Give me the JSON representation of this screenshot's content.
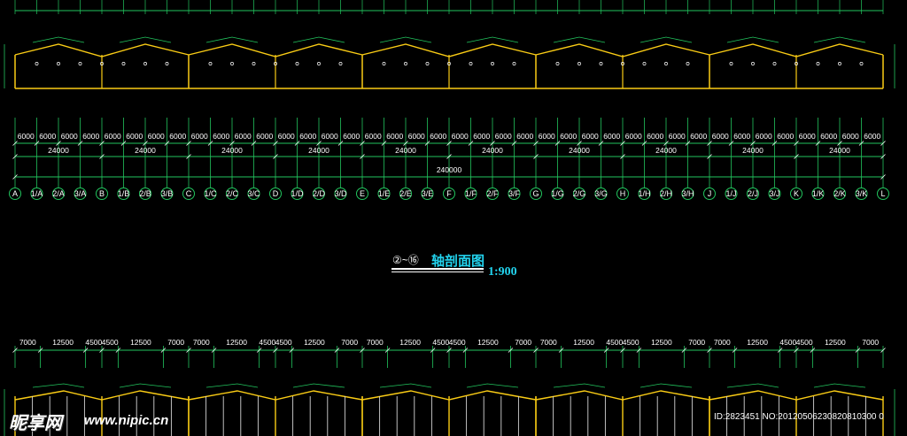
{
  "colors": {
    "background": "#000000",
    "dim_line": "#22c55e",
    "frame": "#facc15",
    "title": "#22d3ee",
    "text": "#ffffff"
  },
  "top_dim_row": {
    "bays": [
      "6000",
      "6000",
      "6000",
      "6000",
      "6000",
      "6000",
      "6000",
      "6000",
      "6000",
      "6000",
      "6000",
      "6000",
      "6000",
      "6000",
      "6000",
      "6000",
      "6000",
      "6000",
      "6000",
      "6000",
      "6000",
      "6000",
      "6000",
      "6000",
      "6000",
      "6000",
      "6000",
      "6000",
      "6000",
      "6000",
      "6000",
      "6000",
      "6000",
      "6000",
      "6000",
      "6000",
      "6000",
      "6000",
      "6000",
      "6000"
    ],
    "spans": [
      "24000",
      "24000",
      "24000",
      "24000",
      "24000",
      "24000",
      "24000",
      "24000",
      "24000",
      "24000"
    ],
    "total": "240000"
  },
  "axis_labels": [
    "A",
    "1/A",
    "2/A",
    "3/A",
    "B",
    "1/B",
    "2/B",
    "3/B",
    "C",
    "1/C",
    "2/C",
    "3/C",
    "D",
    "1/D",
    "2/D",
    "3/D",
    "E",
    "1/E",
    "2/E",
    "3/E",
    "F",
    "1/F",
    "2/F",
    "3/F",
    "G",
    "1/G",
    "2/G",
    "3/G",
    "H",
    "1/H",
    "2/H",
    "3/H",
    "J",
    "1/J",
    "2/J",
    "3/J",
    "K",
    "1/K",
    "2/K",
    "3/K",
    "L"
  ],
  "title": {
    "axis_range": "②~⑯",
    "text": "轴剖面图",
    "scale": "1:900"
  },
  "bottom_dim_row": {
    "segments": [
      "7000",
      "12500",
      "4500",
      "4500",
      "12500",
      "7000",
      "7000",
      "12500",
      "4500",
      "4500",
      "12500",
      "7000",
      "7000",
      "12500",
      "4500",
      "4500",
      "12500",
      "7000",
      "7000",
      "12500",
      "4500",
      "4500",
      "12500",
      "7000",
      "7000",
      "12500",
      "4500",
      "4500",
      "12500",
      "7000"
    ]
  },
  "watermark": {
    "logo": "昵享网",
    "url": "www.nipic.cn",
    "id": "ID:2823451 NO:20120506230820810300 0"
  }
}
